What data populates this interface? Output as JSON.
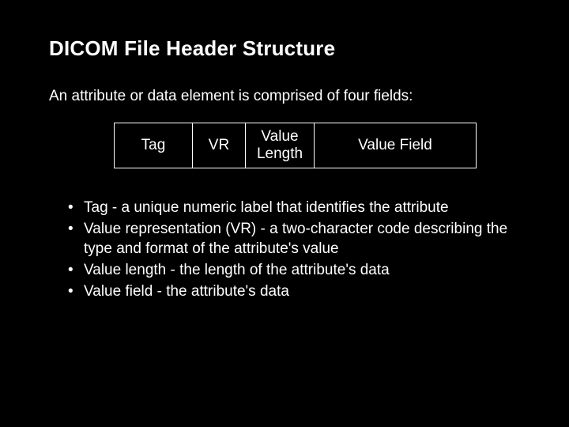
{
  "title": "DICOM File Header Structure",
  "intro": "An attribute or data element is comprised of four fields:",
  "fields": {
    "tag": "Tag",
    "vr": "VR",
    "value_length": "Value Length",
    "value_field": "Value Field"
  },
  "bullets": [
    "Tag - a unique numeric label that identifies the attribute",
    "Value representation (VR) - a two-character code describing the type and format of the attribute's value",
    "Value length - the length of the attribute's data",
    "Value field - the attribute's data"
  ]
}
